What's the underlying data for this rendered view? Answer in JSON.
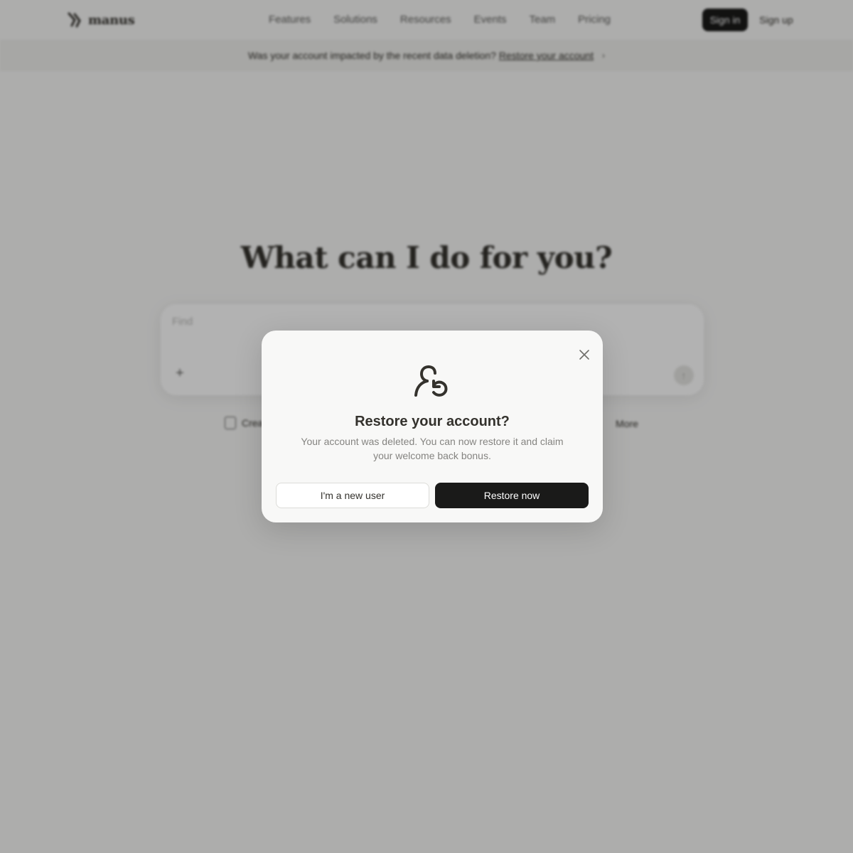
{
  "navbar": {
    "brand_name": "manus",
    "links": [
      "Features",
      "Solutions",
      "Resources",
      "Events",
      "Team",
      "Pricing"
    ],
    "signin_label": "Sign in",
    "signup_label": "Sign up"
  },
  "banner": {
    "text": "Was your account impacted by the recent data deletion?",
    "link_text": "Restore your account"
  },
  "hero": {
    "title": "What can I do for you?"
  },
  "composer": {
    "placeholder": "Find"
  },
  "quick_actions": {
    "first_label": "Crea",
    "more_label": "More"
  },
  "modal": {
    "icon": "user-restore-icon",
    "title": "Restore your account?",
    "description": "Your account was deleted. You can now restore it and claim your welcome back bonus.",
    "secondary_button": "I'm a new user",
    "primary_button": "Restore now"
  },
  "colors": {
    "primary_button_bg": "#1a1a19",
    "overlay": "rgba(0,0,0,0.30)",
    "modal_bg": "#f8f8f7",
    "text_primary": "#34322d",
    "text_secondary": "#858481"
  }
}
